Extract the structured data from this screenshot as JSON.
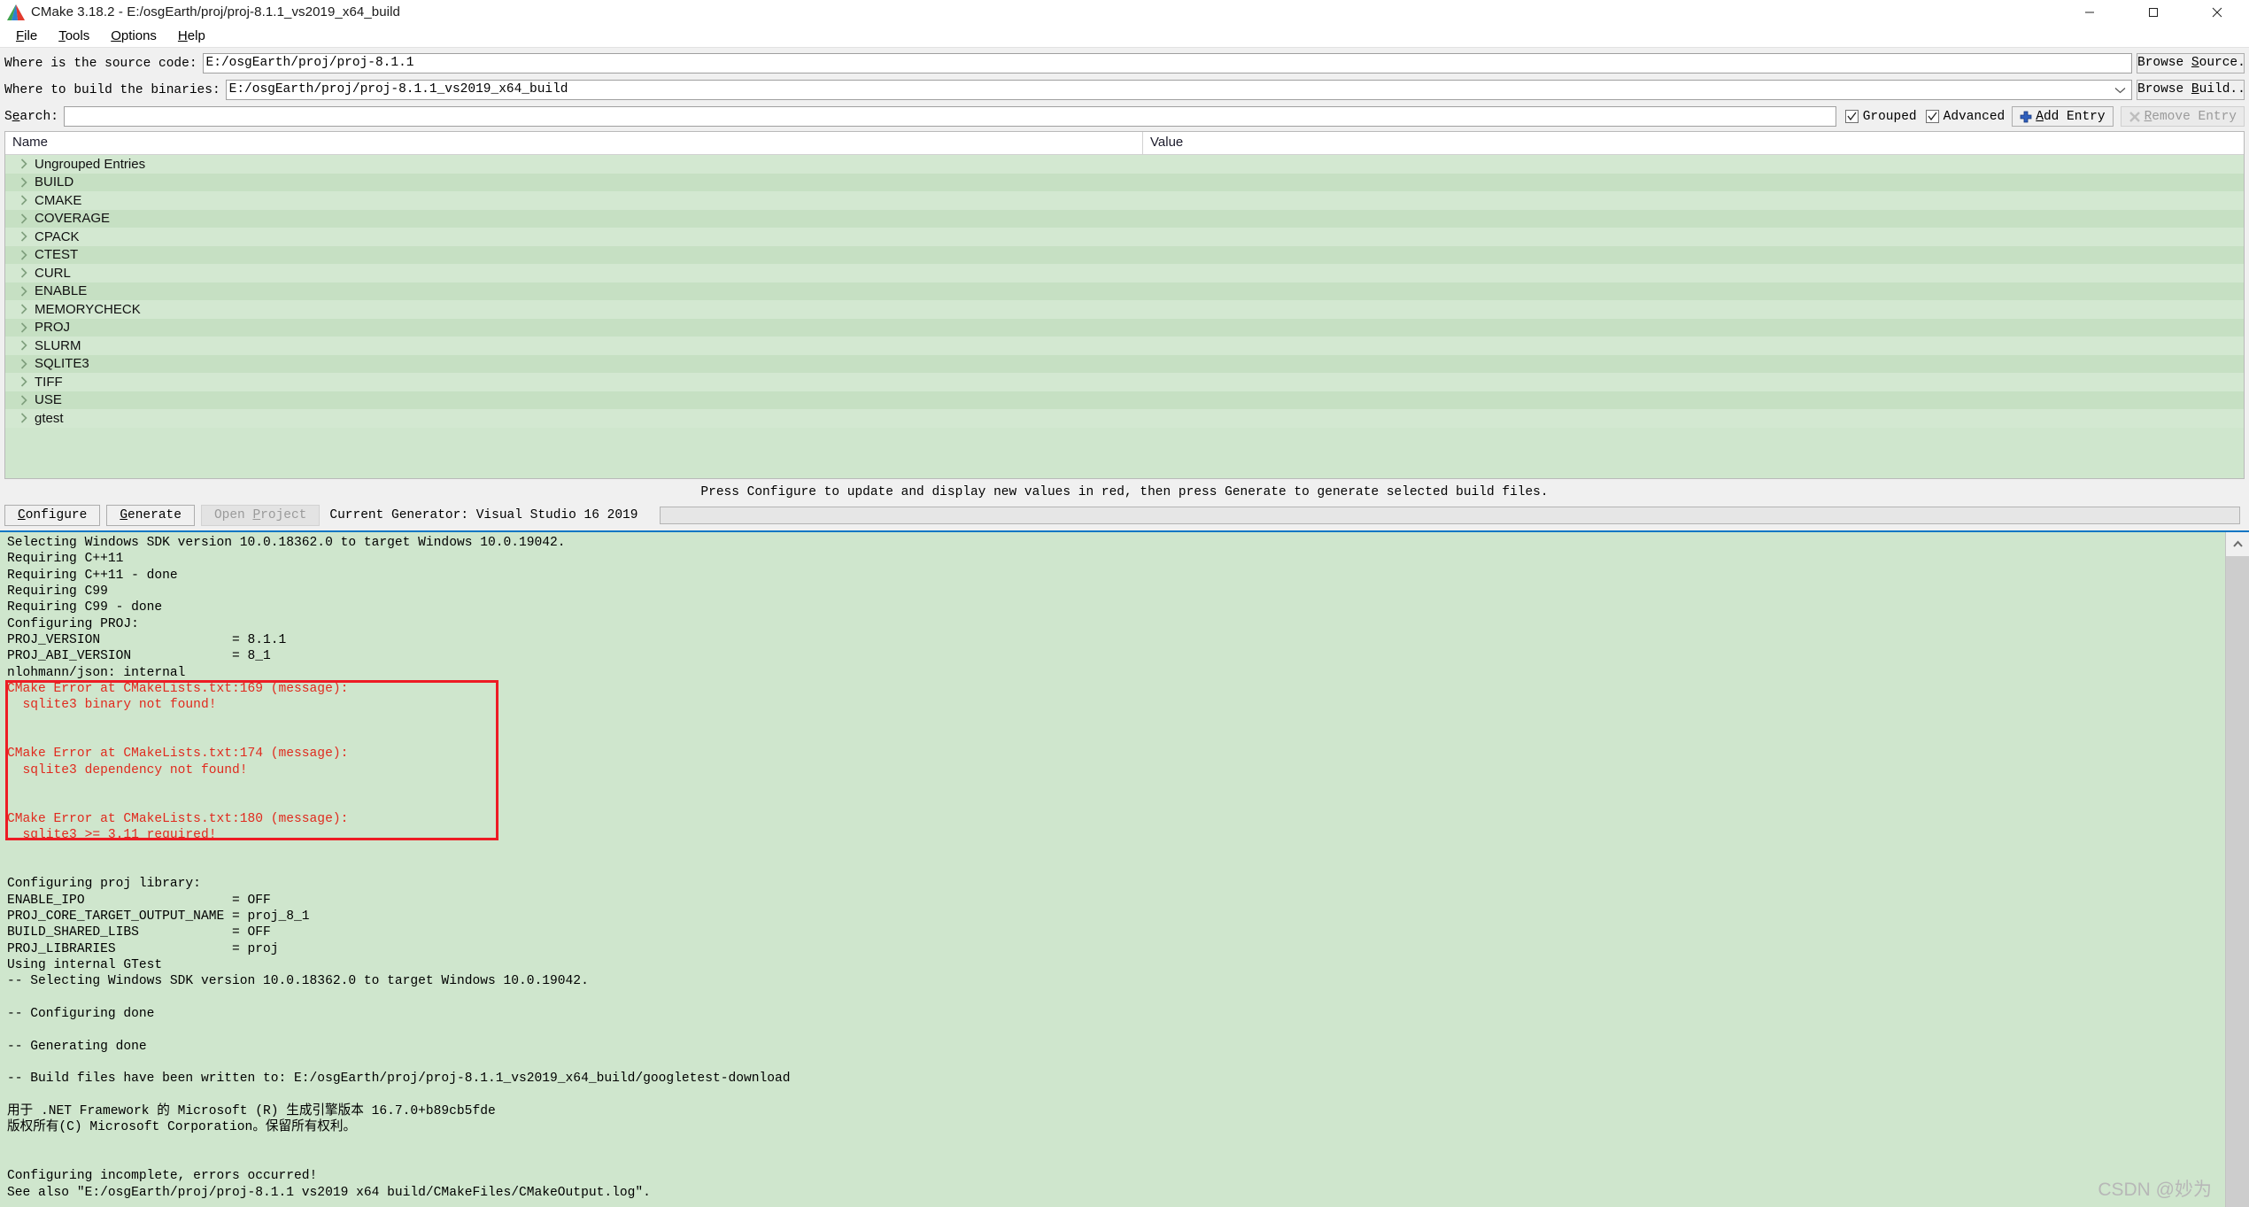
{
  "window": {
    "title": "CMake 3.18.2 - E:/osgEarth/proj/proj-8.1.1_vs2019_x64_build",
    "icon": "cmake-logo-icon",
    "minimize": "minimize-icon",
    "maximize": "maximize-icon",
    "close": "close-icon"
  },
  "menu": {
    "items": [
      {
        "label": "File",
        "accel": "F"
      },
      {
        "label": "Tools",
        "accel": "T"
      },
      {
        "label": "Options",
        "accel": "O"
      },
      {
        "label": "Help",
        "accel": "H"
      }
    ]
  },
  "fields": {
    "source_label": "Where is the source code:",
    "source_value": "E:/osgEarth/proj/proj-8.1.1",
    "source_browse": "Browse Source...",
    "source_browse_accel": "S",
    "build_label": "Where to build the binaries:",
    "build_value": "E:/osgEarth/proj/proj-8.1.1_vs2019_x64_build",
    "build_browse": "Browse Build...",
    "build_browse_accel": "B",
    "search_label": "Search:",
    "search_value": "",
    "search_placeholder": "",
    "grouped_label": "Grouped",
    "grouped_checked": true,
    "advanced_label": "Advanced",
    "advanced_checked": true,
    "add_entry_label": "Add Entry",
    "add_entry_accel": "A",
    "remove_entry_label": "Remove Entry",
    "remove_entry_accel": "R",
    "remove_entry_disabled": true
  },
  "cache_table": {
    "columns": [
      "Name",
      "Value"
    ],
    "rows": [
      {
        "name": "Ungrouped Entries",
        "value": "",
        "expanded": false
      },
      {
        "name": "BUILD",
        "value": "",
        "expanded": false
      },
      {
        "name": "CMAKE",
        "value": "",
        "expanded": false
      },
      {
        "name": "COVERAGE",
        "value": "",
        "expanded": false
      },
      {
        "name": "CPACK",
        "value": "",
        "expanded": false
      },
      {
        "name": "CTEST",
        "value": "",
        "expanded": false
      },
      {
        "name": "CURL",
        "value": "",
        "expanded": false
      },
      {
        "name": "ENABLE",
        "value": "",
        "expanded": false
      },
      {
        "name": "MEMORYCHECK",
        "value": "",
        "expanded": false
      },
      {
        "name": "PROJ",
        "value": "",
        "expanded": false
      },
      {
        "name": "SLURM",
        "value": "",
        "expanded": false
      },
      {
        "name": "SQLITE3",
        "value": "",
        "expanded": false
      },
      {
        "name": "TIFF",
        "value": "",
        "expanded": false
      },
      {
        "name": "USE",
        "value": "",
        "expanded": false
      },
      {
        "name": "gtest",
        "value": "",
        "expanded": false
      }
    ]
  },
  "hint": "Press Configure to update and display new values in red, then press Generate to generate selected build files.",
  "actions": {
    "configure": "Configure",
    "configure_accel": "C",
    "generate": "Generate",
    "generate_accel": "G",
    "open_project": "Open Project",
    "open_project_accel": "P",
    "open_project_disabled": true,
    "current_generator": "Current Generator: Visual Studio 16 2019",
    "progress_percent": 0
  },
  "log": {
    "lines": [
      {
        "text": "Selecting Windows SDK version 10.0.18362.0 to target Windows 10.0.19042.",
        "error": false
      },
      {
        "text": "Requiring C++11",
        "error": false
      },
      {
        "text": "Requiring C++11 - done",
        "error": false
      },
      {
        "text": "Requiring C99",
        "error": false
      },
      {
        "text": "Requiring C99 - done",
        "error": false
      },
      {
        "text": "Configuring PROJ:",
        "error": false
      },
      {
        "text": "PROJ_VERSION                 = 8.1.1",
        "error": false
      },
      {
        "text": "PROJ_ABI_VERSION             = 8_1",
        "error": false
      },
      {
        "text": "nlohmann/json: internal",
        "error": false
      },
      {
        "text": "CMake Error at CMakeLists.txt:169 (message):",
        "error": true
      },
      {
        "text": "  sqlite3 binary not found!",
        "error": true
      },
      {
        "text": "",
        "error": true
      },
      {
        "text": "",
        "error": true
      },
      {
        "text": "CMake Error at CMakeLists.txt:174 (message):",
        "error": true
      },
      {
        "text": "  sqlite3 dependency not found!",
        "error": true
      },
      {
        "text": "",
        "error": true
      },
      {
        "text": "",
        "error": true
      },
      {
        "text": "CMake Error at CMakeLists.txt:180 (message):",
        "error": true
      },
      {
        "text": "  sqlite3 >= 3.11 required!",
        "error": true
      },
      {
        "text": "",
        "error": false
      },
      {
        "text": "",
        "error": false
      },
      {
        "text": "Configuring proj library:",
        "error": false
      },
      {
        "text": "ENABLE_IPO                   = OFF",
        "error": false
      },
      {
        "text": "PROJ_CORE_TARGET_OUTPUT_NAME = proj_8_1",
        "error": false
      },
      {
        "text": "BUILD_SHARED_LIBS            = OFF",
        "error": false
      },
      {
        "text": "PROJ_LIBRARIES               = proj",
        "error": false
      },
      {
        "text": "Using internal GTest",
        "error": false
      },
      {
        "text": "-- Selecting Windows SDK version 10.0.18362.0 to target Windows 10.0.19042.",
        "error": false
      },
      {
        "text": "",
        "error": false
      },
      {
        "text": "-- Configuring done",
        "error": false
      },
      {
        "text": "",
        "error": false
      },
      {
        "text": "-- Generating done",
        "error": false
      },
      {
        "text": "",
        "error": false
      },
      {
        "text": "-- Build files have been written to: E:/osgEarth/proj/proj-8.1.1_vs2019_x64_build/googletest-download",
        "error": false
      },
      {
        "text": "",
        "error": false
      },
      {
        "text": "用于 .NET Framework 的 Microsoft (R) 生成引擎版本 16.7.0+b89cb5fde",
        "error": false
      },
      {
        "text": "版权所有(C) Microsoft Corporation。保留所有权利。",
        "error": false
      },
      {
        "text": "",
        "error": false
      },
      {
        "text": "",
        "error": false
      },
      {
        "text": "Configuring incomplete, errors occurred!",
        "error": false
      },
      {
        "text": "See also \"E:/osgEarth/proj/proj-8.1.1 vs2019 x64 build/CMakeFiles/CMakeOutput.log\".",
        "error": false
      }
    ],
    "error_highlight_box": true,
    "scroll_up_icon": "scroll-up-arrow-icon"
  },
  "watermark": "CSDN @妙为",
  "colors": {
    "tree_green": "#cfe6cd",
    "tree_green_alt": "#c6e0c3",
    "error_red": "#e02a1e",
    "highlight_box_red": "#ed1c24",
    "accent_blue": "#0b76c4"
  }
}
